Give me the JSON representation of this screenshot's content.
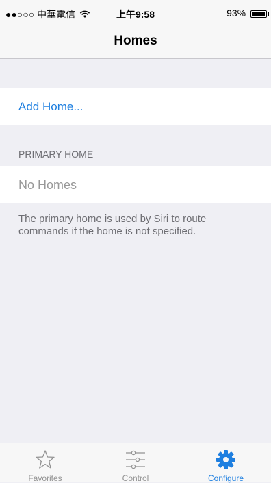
{
  "status_bar": {
    "carrier": "●●○○○ 中華電信",
    "wifi_icon": "wifi-icon",
    "time": "上午9:58",
    "battery_percent": "93%",
    "battery_level": 0.93
  },
  "nav_bar": {
    "title": "Homes"
  },
  "add_home": {
    "label": "Add Home..."
  },
  "primary_home": {
    "header": "PRIMARY HOME",
    "value": "No Homes",
    "footer": "The primary home is used by Siri to route commands if the home is not specified."
  },
  "tab_bar": {
    "tabs": [
      {
        "label": "Favorites",
        "icon": "star-icon",
        "active": false
      },
      {
        "label": "Control",
        "icon": "sliders-icon",
        "active": false
      },
      {
        "label": "Configure",
        "icon": "gear-icon",
        "active": true
      }
    ]
  },
  "colors": {
    "accent": "#1e7fe0",
    "background": "#efeff4",
    "inactive": "#929292"
  }
}
